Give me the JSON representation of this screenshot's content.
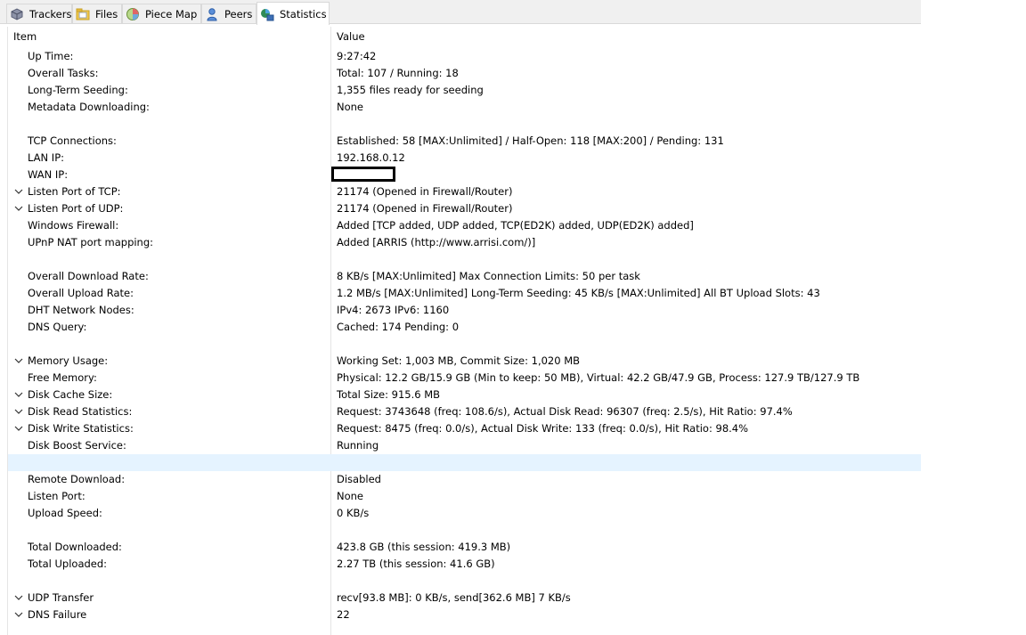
{
  "tabs": [
    {
      "label": "Trackers",
      "icon": "trackers-icon",
      "active": false
    },
    {
      "label": "Files",
      "icon": "files-icon",
      "active": false
    },
    {
      "label": "Piece Map",
      "icon": "piece-map-icon",
      "active": false
    },
    {
      "label": "Peers",
      "icon": "peers-icon",
      "active": false
    },
    {
      "label": "Statistics",
      "icon": "statistics-icon",
      "active": true
    }
  ],
  "table": {
    "columns": [
      "Item",
      "Value"
    ],
    "rows": [
      {
        "label": "Up Time:",
        "value": "9:27:42",
        "expander": false
      },
      {
        "label": "Overall Tasks:",
        "value": "Total: 107 / Running: 18",
        "expander": false
      },
      {
        "label": "Long-Term Seeding:",
        "value": "1,355 files ready for seeding",
        "expander": false
      },
      {
        "label": "Metadata Downloading:",
        "value": "None",
        "expander": false
      },
      {
        "label": "",
        "value": "",
        "expander": false
      },
      {
        "label": "TCP Connections:",
        "value": "Established: 58 [MAX:Unlimited] / Half-Open: 118 [MAX:200] / Pending: 131",
        "expander": false
      },
      {
        "label": "LAN IP:",
        "value": "192.168.0.12",
        "expander": false
      },
      {
        "label": "WAN IP:",
        "value": "",
        "expander": false,
        "redacted": true
      },
      {
        "label": "Listen Port of TCP:",
        "value": "21174 (Opened in Firewall/Router)",
        "expander": true
      },
      {
        "label": "Listen Port of UDP:",
        "value": "21174 (Opened in Firewall/Router)",
        "expander": true
      },
      {
        "label": "Windows Firewall:",
        "value": "Added [TCP added, UDP added, TCP(ED2K) added, UDP(ED2K) added]",
        "expander": false
      },
      {
        "label": "UPnP NAT port mapping:",
        "value": "Added [ARRIS (http://www.arrisi.com/)]",
        "expander": false
      },
      {
        "label": "",
        "value": "",
        "expander": false
      },
      {
        "label": "Overall Download Rate:",
        "value": "8 KB/s [MAX:Unlimited]     Max Connection Limits: 50 per task",
        "expander": false
      },
      {
        "label": "Overall Upload Rate:",
        "value": "1.2 MB/s [MAX:Unlimited]     Long-Term Seeding: 45 KB/s [MAX:Unlimited]     All BT Upload Slots: 43",
        "expander": false
      },
      {
        "label": "DHT Network Nodes:",
        "value": "IPv4: 2673  IPv6: 1160",
        "expander": false
      },
      {
        "label": "DNS Query:",
        "value": "Cached: 174   Pending: 0",
        "expander": false
      },
      {
        "label": "",
        "value": "",
        "expander": false
      },
      {
        "label": "Memory Usage:",
        "value": "Working Set: 1,003 MB, Commit Size: 1,020 MB",
        "expander": true
      },
      {
        "label": "Free Memory:",
        "value": "Physical: 12.2 GB/15.9 GB (Min to keep: 50 MB), Virtual: 42.2 GB/47.9 GB, Process: 127.9 TB/127.9 TB",
        "expander": false
      },
      {
        "label": "Disk Cache Size:",
        "value": "Total Size: 915.6 MB",
        "expander": true
      },
      {
        "label": "Disk Read Statistics:",
        "value": "Request: 3743648 (freq: 108.6/s), Actual Disk Read: 96307 (freq: 2.5/s), Hit Ratio: 97.4%",
        "expander": true
      },
      {
        "label": "Disk Write Statistics:",
        "value": "Request: 8475 (freq: 0.0/s), Actual Disk Write: 133 (freq: 0.0/s), Hit Ratio: 98.4%",
        "expander": true
      },
      {
        "label": "Disk Boost Service:",
        "value": "Running",
        "expander": false
      },
      {
        "label": "",
        "value": "",
        "expander": false,
        "selected": true
      },
      {
        "label": "Remote Download:",
        "value": "Disabled",
        "expander": false
      },
      {
        "label": "Listen Port:",
        "value": "None",
        "expander": false
      },
      {
        "label": "Upload Speed:",
        "value": "0 KB/s",
        "expander": false
      },
      {
        "label": "",
        "value": "",
        "expander": false
      },
      {
        "label": "Total Downloaded:",
        "value": "423.8 GB (this session: 419.3 MB)",
        "expander": false
      },
      {
        "label": "Total Uploaded:",
        "value": "2.27 TB (this session: 41.6 GB)",
        "expander": false
      },
      {
        "label": "",
        "value": "",
        "expander": false
      },
      {
        "label": "UDP Transfer",
        "value": "recv[93.8 MB]: 0 KB/s, send[362.6 MB] 7 KB/s",
        "expander": true
      },
      {
        "label": "DNS Failure",
        "value": "22",
        "expander": true
      }
    ]
  }
}
